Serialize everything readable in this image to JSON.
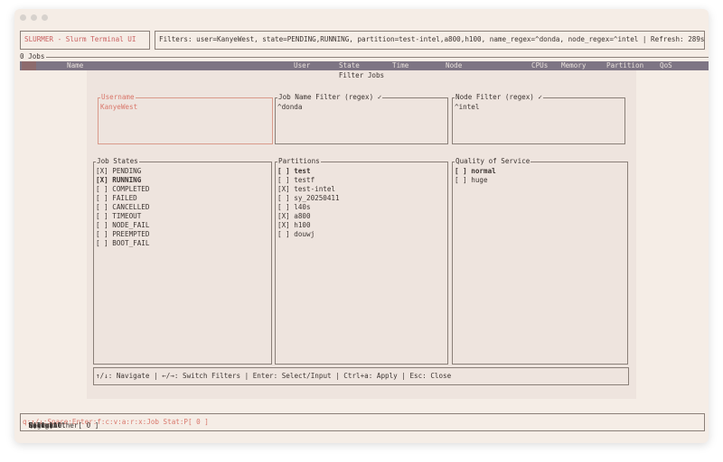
{
  "app": {
    "title": "SLURMER - Slurm Terminal UI"
  },
  "filters_bar": {
    "text": "Filters: user=KanyeWest, state=PENDING,RUNNING, partition=test-intel,a800,h100, name_regex=^donda, node_regex=^intel | Refresh: 289s"
  },
  "jobs": {
    "count_label": "0 Jobs"
  },
  "table": {
    "columns": [
      "Name",
      "User",
      "State",
      "Time",
      "Node",
      "CPUs",
      "Memory",
      "Partition",
      "QoS"
    ]
  },
  "modal": {
    "title": "Filter Jobs",
    "username": {
      "label": "Username",
      "value": "KanyeWest"
    },
    "job_name": {
      "label": "Job Name Filter (regex) ✓",
      "value": "^donda"
    },
    "node": {
      "label": "Node Filter (regex) ✓",
      "value": "^intel"
    },
    "job_states": {
      "label": "Job States",
      "items": [
        {
          "text": "[X] PENDING",
          "bold": false
        },
        {
          "text": "[X] RUNNING",
          "bold": true
        },
        {
          "text": "[ ] COMPLETED",
          "bold": false
        },
        {
          "text": "[ ] FAILED",
          "bold": false
        },
        {
          "text": "[ ] CANCELLED",
          "bold": false
        },
        {
          "text": "[ ] TIMEOUT",
          "bold": false
        },
        {
          "text": "[ ] NODE_FAIL",
          "bold": false
        },
        {
          "text": "[ ] PREEMPTED",
          "bold": false
        },
        {
          "text": "[ ] BOOT_FAIL",
          "bold": false
        }
      ]
    },
    "partitions": {
      "label": "Partitions",
      "items": [
        {
          "text": "[ ] test",
          "bold": true
        },
        {
          "text": "[ ] testf",
          "bold": false
        },
        {
          "text": "[X] test-intel",
          "bold": false
        },
        {
          "text": "[ ] sy_20250411",
          "bold": false
        },
        {
          "text": "[ ] l40s",
          "bold": false
        },
        {
          "text": "[X] a800",
          "bold": false
        },
        {
          "text": "[X] h100",
          "bold": false
        },
        {
          "text": "[ ] douwj",
          "bold": false
        }
      ]
    },
    "qos": {
      "label": "Quality of Service",
      "items": [
        {
          "text": "[ ] normal",
          "bold": true
        },
        {
          "text": "[ ] huge",
          "bold": false
        }
      ]
    },
    "help": "↑/↓: Navigate | ←/→: Switch Filters | Enter: Select/Input | Ctrl+a: Apply | Esc: Close"
  },
  "status_bar": {
    "segments": [
      {
        "text": "q:",
        "accent": true
      },
      {
        "text": " Quit ",
        "accent": false
      },
      {
        "text": "↑/↓:",
        "accent": true
      },
      {
        "text": " Navigate ",
        "accent": false
      },
      {
        "text": "Space:",
        "accent": true
      },
      {
        "text": " Select ",
        "accent": false
      },
      {
        "text": "Enter:",
        "accent": true
      },
      {
        "text": " Script ",
        "accent": false
      },
      {
        "text": "f:",
        "accent": true
      },
      {
        "text": " Filter ",
        "accent": false
      },
      {
        "text": "c:",
        "accent": true
      },
      {
        "text": " Columns ",
        "accent": false
      },
      {
        "text": "v:",
        "accent": true
      },
      {
        "text": " Log ",
        "accent": false
      },
      {
        "text": "a:",
        "accent": true
      },
      {
        "text": " SelectAll ",
        "accent": false
      },
      {
        "text": "r:",
        "accent": true
      },
      {
        "text": " Refresh ",
        "accent": false
      },
      {
        "text": "x:",
        "accent": true
      },
      {
        "text": " Cancel ",
        "accent": false
      },
      {
        "text": "Job Stat:",
        "accent": true
      },
      {
        "text": " ",
        "accent": false
      },
      {
        "text": "P[ 0 ]",
        "accent": true
      },
      {
        "text": " R[ 0 ] Other[ 0 ]",
        "accent": false
      }
    ]
  },
  "colors": {
    "accent": "#d9776b",
    "header_bg": "#7e7584",
    "background": "#f5ede6"
  }
}
